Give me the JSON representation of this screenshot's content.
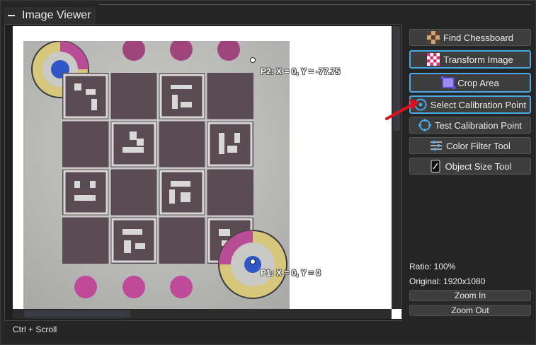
{
  "panel": {
    "title": "Image Viewer"
  },
  "buttons": [
    {
      "id": "find-chessboard",
      "label": "Find Chessboard",
      "icon": "chessboard-icon",
      "active": false
    },
    {
      "id": "transform-image",
      "label": "Transform Image",
      "icon": "checker-pink-icon",
      "active": true
    },
    {
      "id": "crop-area",
      "label": "Crop Area",
      "icon": "crop-icon",
      "active": true
    },
    {
      "id": "select-calibration-point",
      "label": "Select Calibration Point",
      "icon": "target-icon",
      "active": true
    },
    {
      "id": "test-calibration-point",
      "label": "Test Calibration Point",
      "icon": "crosshair-icon",
      "active": false
    },
    {
      "id": "color-filter-tool",
      "label": "Color Filter Tool",
      "icon": "sliders-icon",
      "active": false
    },
    {
      "id": "object-size-tool",
      "label": "Object Size Tool",
      "icon": "ruler-icon",
      "active": false
    }
  ],
  "info": {
    "ratio": "Ratio: 100%",
    "original": "Original: 1920x1080"
  },
  "zoom": {
    "zoom_in": "Zoom In",
    "zoom_out": "Zoom Out"
  },
  "hint": "Ctrl + Scroll",
  "overlay": {
    "p1": "P1: X = 0, Y = 0",
    "p2": "P2: X = 0, Y = -77.75"
  },
  "colors": {
    "accent": "#4aa8e8",
    "arrow": "#e0101a",
    "marker_magenta": "#c04a9a",
    "marker_blue": "#2f56c6",
    "marker_ring": "#d8c878"
  }
}
